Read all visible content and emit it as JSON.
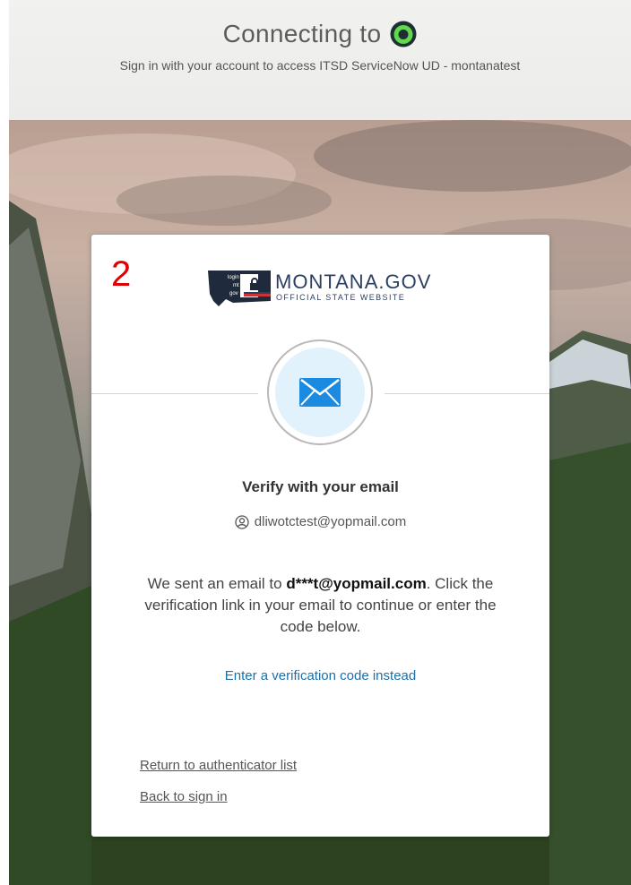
{
  "header": {
    "connecting": "Connecting to",
    "subtitle": "Sign in with your account to access ITSD ServiceNow UD - montanatest"
  },
  "card": {
    "step_number": "2",
    "brand": {
      "name": "MONTANA.GOV",
      "tagline": "OFFICIAL STATE WEBSITE",
      "badge_lines": [
        "login",
        "mt",
        "gov"
      ]
    },
    "title": "Verify with your email",
    "identity": "dliwotctest@yopmail.com",
    "desc_pre": "We sent an email to ",
    "desc_email": "d***t@yopmail.com",
    "desc_post": ". Click the verification link in your email to continue or enter the code below.",
    "alt_link": "Enter a verification code instead",
    "return_link": "Return to authenticator list",
    "back_link": "Back to sign in"
  },
  "colors": {
    "link": "#1c6fa8",
    "step_number": "#e00000",
    "brand_navy": "#2c3f63",
    "servicenow_green": "#62d84e"
  },
  "icons": [
    "servicenow-logo",
    "montana-state-icon",
    "lock-icon",
    "email-icon",
    "user-icon"
  ]
}
